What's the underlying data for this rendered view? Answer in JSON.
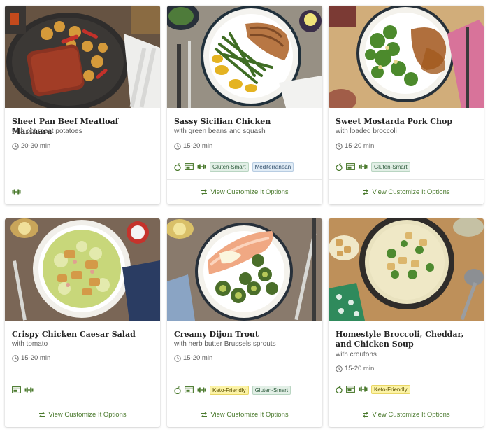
{
  "customize_label": "View Customize It Options",
  "colors": {
    "accent_green": "#4b7a2e",
    "tag_green_bg": "#e2efe6",
    "tag_blue_bg": "#e1ecf6",
    "tag_yellow_bg": "#fcf3a6"
  },
  "recipes": [
    {
      "title": "Sheet Pan Beef Meatloaf Marinara",
      "subtitle": "with pot roast potatoes",
      "time": "20-30 min",
      "icons": [
        "dumbbell-icon"
      ],
      "tags": []
    },
    {
      "title": "Sassy Sicilian Chicken",
      "subtitle": "with green beans and squash",
      "time": "15-20 min",
      "icons": [
        "apple-icon",
        "oven-icon",
        "dumbbell-icon"
      ],
      "tags": [
        {
          "label": "Gluten-Smart",
          "color": "green"
        },
        {
          "label": "Mediterranean",
          "color": "blue"
        }
      ]
    },
    {
      "title": "Sweet Mostarda Pork Chop",
      "subtitle": "with loaded broccoli",
      "time": "15-20 min",
      "icons": [
        "apple-icon",
        "oven-icon",
        "dumbbell-icon"
      ],
      "tags": [
        {
          "label": "Gluten-Smart",
          "color": "green"
        }
      ]
    },
    {
      "title": "Crispy Chicken Caesar Salad",
      "subtitle": "with tomato",
      "time": "15-20 min",
      "icons": [
        "oven-icon",
        "dumbbell-icon"
      ],
      "tags": []
    },
    {
      "title": "Creamy Dijon Trout",
      "subtitle": "with herb butter Brussels sprouts",
      "time": "15-20 min",
      "icons": [
        "apple-icon",
        "oven-icon",
        "dumbbell-icon"
      ],
      "tags": [
        {
          "label": "Keto-Friendly",
          "color": "yellow"
        },
        {
          "label": "Gluten-Smart",
          "color": "green"
        }
      ]
    },
    {
      "title": "Homestyle Broccoli, Cheddar, and Chicken Soup",
      "subtitle": "with croutons",
      "time": "15-20 min",
      "icons": [
        "apple-icon",
        "oven-icon",
        "dumbbell-icon"
      ],
      "tags": [
        {
          "label": "Keto-Friendly",
          "color": "yellow"
        }
      ]
    }
  ]
}
